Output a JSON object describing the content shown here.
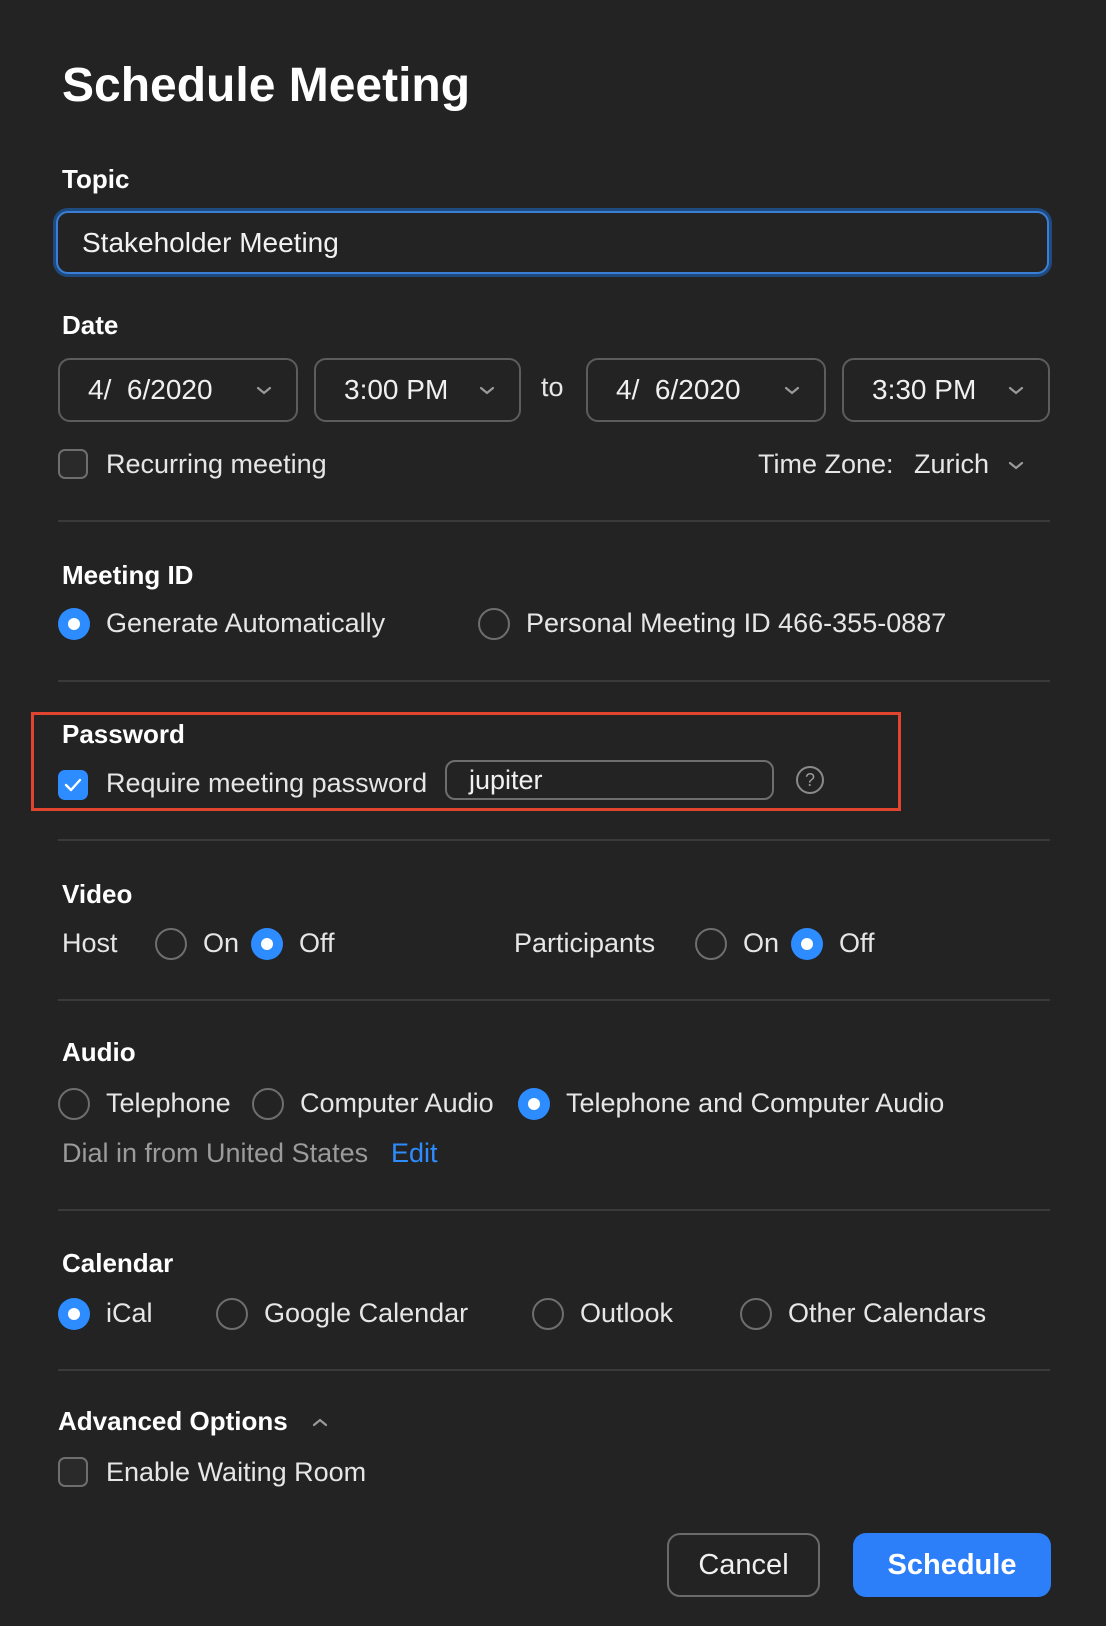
{
  "dialog": {
    "title": "Schedule Meeting"
  },
  "topic": {
    "label": "Topic",
    "value": "Stakeholder Meeting"
  },
  "date": {
    "label": "Date",
    "start_date": "4/  6/2020",
    "start_time": "3:00 PM",
    "to_label": "to",
    "end_date": "4/  6/2020",
    "end_time": "3:30 PM",
    "recurring_label": "Recurring meeting",
    "recurring_checked": false,
    "timezone_label": "Time Zone:",
    "timezone_value": "Zurich"
  },
  "meeting_id": {
    "label": "Meeting ID",
    "options": [
      "Generate Automatically",
      "Personal Meeting ID 466-355-0887"
    ],
    "selected": "Generate Automatically"
  },
  "password": {
    "label": "Password",
    "require_label": "Require meeting password",
    "require_checked": true,
    "value": "jupiter",
    "help_glyph": "?"
  },
  "video": {
    "label": "Video",
    "host_label": "Host",
    "participants_label": "Participants",
    "on_label": "On",
    "off_label": "Off",
    "host_selected": "Off",
    "participants_selected": "Off"
  },
  "audio": {
    "label": "Audio",
    "options": [
      "Telephone",
      "Computer Audio",
      "Telephone and Computer Audio"
    ],
    "selected": "Telephone and Computer Audio",
    "dial_in_text": "Dial in from United States",
    "edit_label": "Edit"
  },
  "calendar": {
    "label": "Calendar",
    "options": [
      "iCal",
      "Google Calendar",
      "Outlook",
      "Other Calendars"
    ],
    "selected": "iCal"
  },
  "advanced": {
    "label": "Advanced Options",
    "waiting_room_label": "Enable Waiting Room",
    "waiting_room_checked": false
  },
  "buttons": {
    "cancel": "Cancel",
    "schedule": "Schedule"
  },
  "colors": {
    "accent": "#2d8cff",
    "highlight_border": "#e2452f",
    "background": "#232323"
  }
}
